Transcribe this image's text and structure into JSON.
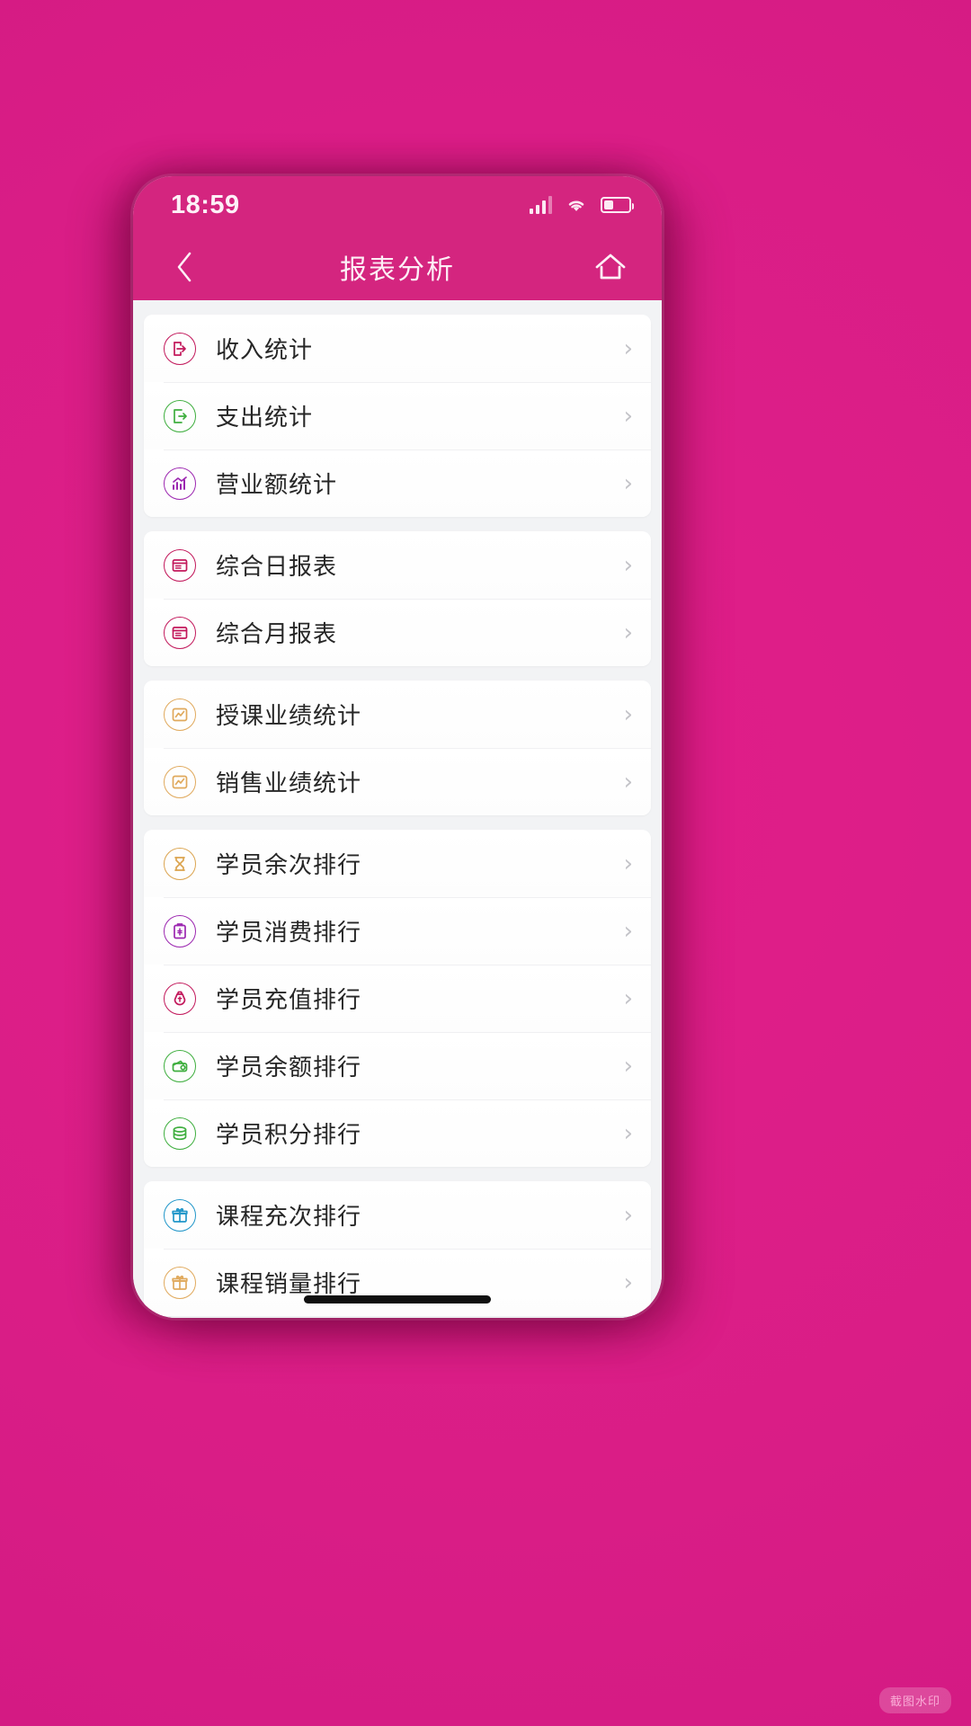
{
  "theme": {
    "page_background": "#e0218a",
    "header_background": "#d4257f",
    "content_background": "#f2f3f5",
    "card_background": "#ffffff",
    "label_color": "#262626",
    "chevron_color": "#c3c3c8"
  },
  "status_bar": {
    "clock": "18:59",
    "signal_icon": "signal-bars-icon",
    "wifi_icon": "wifi-icon",
    "battery_icon": "battery-icon",
    "battery_level": "38%"
  },
  "nav": {
    "back_icon": "chevron-left-icon",
    "title": "报表分析",
    "home_icon": "home-icon"
  },
  "chevron_glyph": "›",
  "groups": [
    {
      "id": "group-statistics",
      "rows": [
        {
          "label": "收入统计",
          "icon": "arrow-into-door-icon",
          "color": "#c2185b"
        },
        {
          "label": "支出统计",
          "icon": "arrow-out-door-icon",
          "color": "#3eae3e"
        },
        {
          "label": "营业额统计",
          "icon": "bar-chart-trend-icon",
          "color": "#9c27b0"
        }
      ]
    },
    {
      "id": "group-reports",
      "rows": [
        {
          "label": "综合日报表",
          "icon": "report-window-icon",
          "color": "#c2185b"
        },
        {
          "label": "综合月报表",
          "icon": "report-window-icon",
          "color": "#c2185b"
        }
      ]
    },
    {
      "id": "group-performance",
      "rows": [
        {
          "label": "授课业绩统计",
          "icon": "line-chart-box-icon",
          "color": "#e0a95c"
        },
        {
          "label": "销售业绩统计",
          "icon": "line-chart-box-icon",
          "color": "#e0a95c"
        }
      ]
    },
    {
      "id": "group-student-rankings",
      "rows": [
        {
          "label": "学员余次排行",
          "icon": "hourglass-icon",
          "color": "#dba44f"
        },
        {
          "label": "学员消费排行",
          "icon": "clipboard-money-icon",
          "color": "#9c27b0"
        },
        {
          "label": "学员充值排行",
          "icon": "money-bag-icon",
          "color": "#c2185b"
        },
        {
          "label": "学员余额排行",
          "icon": "wallet-coin-icon",
          "color": "#3eae3e"
        },
        {
          "label": "学员积分排行",
          "icon": "coin-stack-icon",
          "color": "#3eae3e"
        }
      ]
    },
    {
      "id": "group-course-rankings",
      "rows": [
        {
          "label": "课程充次排行",
          "icon": "gift-box-icon",
          "color": "#2196c9"
        },
        {
          "label": "课程销量排行",
          "icon": "gift-box-icon",
          "color": "#e0a95c"
        }
      ]
    }
  ],
  "home_indicator": "home-indicator-bar",
  "watermark": "截图水印"
}
